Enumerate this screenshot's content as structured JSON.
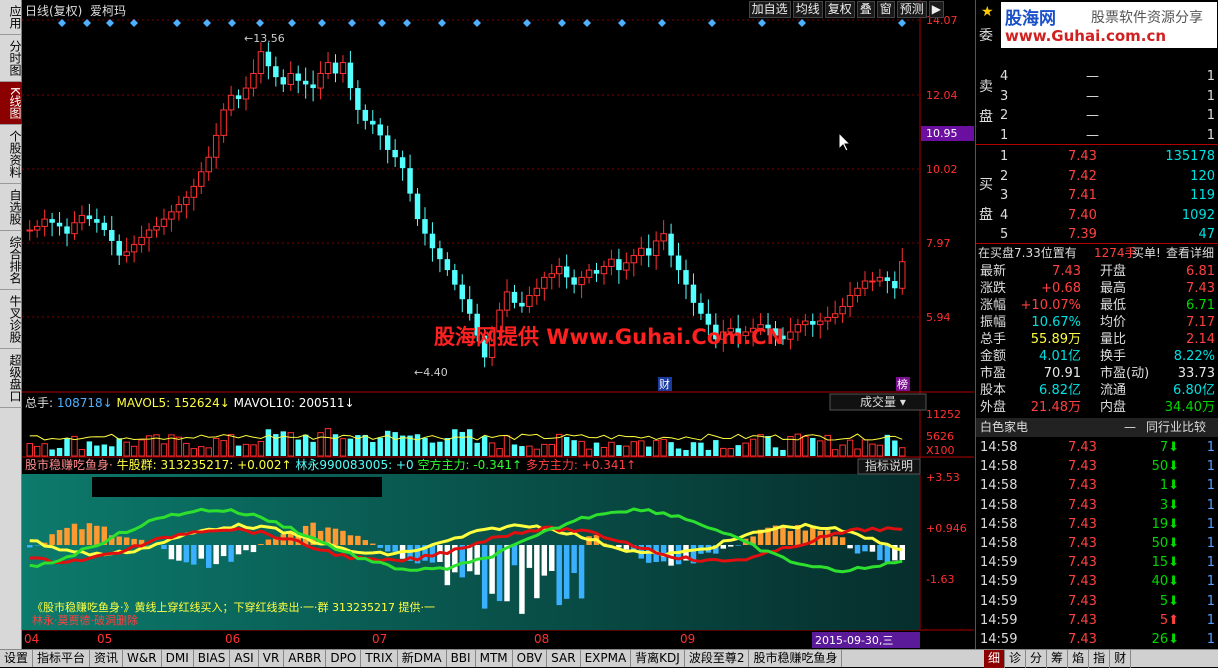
{
  "left_tabs": [
    "应用",
    "分时图",
    "K线图",
    "个股资料",
    "自选股",
    "综合排名",
    "牛叉诊股",
    "超级盘口"
  ],
  "left_tab_active": 2,
  "title": "日线(复权)",
  "stock_name": "爱柯玛",
  "toolbar": [
    "加自选",
    "均线",
    "复权",
    "叠",
    "窗",
    "预测"
  ],
  "price_axis": [
    "14.07",
    "12.04",
    "10.02",
    "7.97",
    "5.94"
  ],
  "current_price_tag": "10.95",
  "high_label": "13.56",
  "low_label": "4.40",
  "event_marks": [
    "财",
    "榜"
  ],
  "volume_panel": {
    "label": "总手:",
    "value": "108718",
    "mavol5_label": "MAVOL5:",
    "mavol5": "152624",
    "mavol10_label": "MAVOL10:",
    "mavol10": "200511",
    "dropdown": "成交量",
    "axis": [
      "11252",
      "5626",
      "X100"
    ]
  },
  "indicator": {
    "name": "股市稳赚吃鱼身·",
    "bull_label": "牛股群:",
    "bull": "313235217: +0.002",
    "lin_label": "林永990083005: +0",
    "kong": "空方主力: -0.341",
    "duo": "多方主力: +0.341",
    "btn": "指标说明",
    "axis": [
      "+3.53",
      "+0.946",
      "-1.63"
    ],
    "note1": "《股市稳赚吃鱼身·》黄线上穿红线买入；下穿红线卖出·一·群 313235217 提供·一",
    "note2": "林永·莫贾德·破洞删除"
  },
  "date_axis": [
    "04",
    "05",
    "06",
    "07",
    "08",
    "09"
  ],
  "date_highlight": "2015-09-30,三",
  "watermark": "股海网提供 Www.Guhai.Com.CN",
  "logo": {
    "cn": "股海网",
    "en": "www.Guhai.com.cn",
    "slogan": "股票软件资源分享"
  },
  "sell_book": [
    {
      "lv": "4",
      "p": "—",
      "v": ""
    },
    {
      "lv": "3",
      "p": "—",
      "v": ""
    },
    {
      "lv": "2",
      "p": "—",
      "v": ""
    },
    {
      "lv": "1",
      "p": "—",
      "v": ""
    }
  ],
  "buy_book": [
    {
      "lv": "1",
      "p": "7.43",
      "v": "135178"
    },
    {
      "lv": "2",
      "p": "7.42",
      "v": "120"
    },
    {
      "lv": "3",
      "p": "7.41",
      "v": "119"
    },
    {
      "lv": "4",
      "p": "7.40",
      "v": "1092"
    },
    {
      "lv": "5",
      "p": "7.39",
      "v": "47"
    }
  ],
  "side_labels": {
    "wei": "委",
    "sell": "卖盘",
    "buy": "买盘"
  },
  "buy_info": {
    "text": "在买盘7.33位置有",
    "hand": "1274手",
    "buy": "买单!",
    "detail": "查看详细"
  },
  "quote": [
    {
      "k1": "最新",
      "v1": "7.43",
      "k2": "开盘",
      "v2": "6.81",
      "c1": "red",
      "c2": "red"
    },
    {
      "k1": "涨跌",
      "v1": "+0.68",
      "k2": "最高",
      "v2": "7.43",
      "c1": "red",
      "c2": "red"
    },
    {
      "k1": "涨幅",
      "v1": "+10.07%",
      "k2": "最低",
      "v2": "6.71",
      "c1": "red",
      "c2": "green"
    },
    {
      "k1": "振幅",
      "v1": "10.67%",
      "k2": "均价",
      "v2": "7.17",
      "c1": "cyan",
      "c2": "red"
    },
    {
      "k1": "总手",
      "v1": "55.89万",
      "k2": "量比",
      "v2": "2.14",
      "c1": "yellow",
      "c2": "red"
    },
    {
      "k1": "金额",
      "v1": "4.01亿",
      "k2": "换手",
      "v2": "8.22%",
      "c1": "cyan",
      "c2": "cyan"
    },
    {
      "k1": "市盈",
      "v1": "70.91",
      "k2": "市盈(动)",
      "v2": "33.73",
      "c1": "white",
      "c2": "white"
    },
    {
      "k1": "股本",
      "v1": "6.82亿",
      "k2": "流通",
      "v2": "6.80亿",
      "c1": "cyan",
      "c2": "cyan"
    },
    {
      "k1": "外盘",
      "v1": "21.48万",
      "k2": "内盘",
      "v2": "34.40万",
      "c1": "red",
      "c2": "green"
    }
  ],
  "industry": {
    "name": "白色家电",
    "compare": "同行业比较"
  },
  "ticks": [
    {
      "t": "14:58",
      "p": "7.43",
      "v": "7",
      "d": "1",
      "c": "green"
    },
    {
      "t": "14:58",
      "p": "7.43",
      "v": "50",
      "d": "1",
      "c": "green"
    },
    {
      "t": "14:58",
      "p": "7.43",
      "v": "1",
      "d": "1",
      "c": "green"
    },
    {
      "t": "14:58",
      "p": "7.43",
      "v": "3",
      "d": "1",
      "c": "green"
    },
    {
      "t": "14:58",
      "p": "7.43",
      "v": "19",
      "d": "1",
      "c": "green"
    },
    {
      "t": "14:58",
      "p": "7.43",
      "v": "50",
      "d": "1",
      "c": "green"
    },
    {
      "t": "14:59",
      "p": "7.43",
      "v": "15",
      "d": "1",
      "c": "green"
    },
    {
      "t": "14:59",
      "p": "7.43",
      "v": "40",
      "d": "1",
      "c": "green"
    },
    {
      "t": "14:59",
      "p": "7.43",
      "v": "5",
      "d": "1",
      "c": "green"
    },
    {
      "t": "14:59",
      "p": "7.43",
      "v": "5",
      "d": "1",
      "c": "red"
    },
    {
      "t": "14:59",
      "p": "7.43",
      "v": "26",
      "d": "1",
      "c": "green"
    }
  ],
  "bottom_tabs": [
    "设置",
    "指标平台",
    "资讯",
    "W&R",
    "DMI",
    "BIAS",
    "ASI",
    "VR",
    "ARBR",
    "DPO",
    "TRIX",
    "新DMA",
    "BBI",
    "MTM",
    "OBV",
    "SAR",
    "EXPMA",
    "背离KDJ",
    "波段至尊2",
    "股市稳赚吃鱼身"
  ],
  "right_bottom_tabs": [
    "细",
    "诊",
    "分",
    "筹",
    "焰",
    "指",
    "财"
  ],
  "chart_data": {
    "type": "candlestick",
    "title": "日线(复权)",
    "ylim": [
      4.4,
      14.07
    ],
    "high": 13.56,
    "low": 4.4,
    "last": 7.43
  }
}
